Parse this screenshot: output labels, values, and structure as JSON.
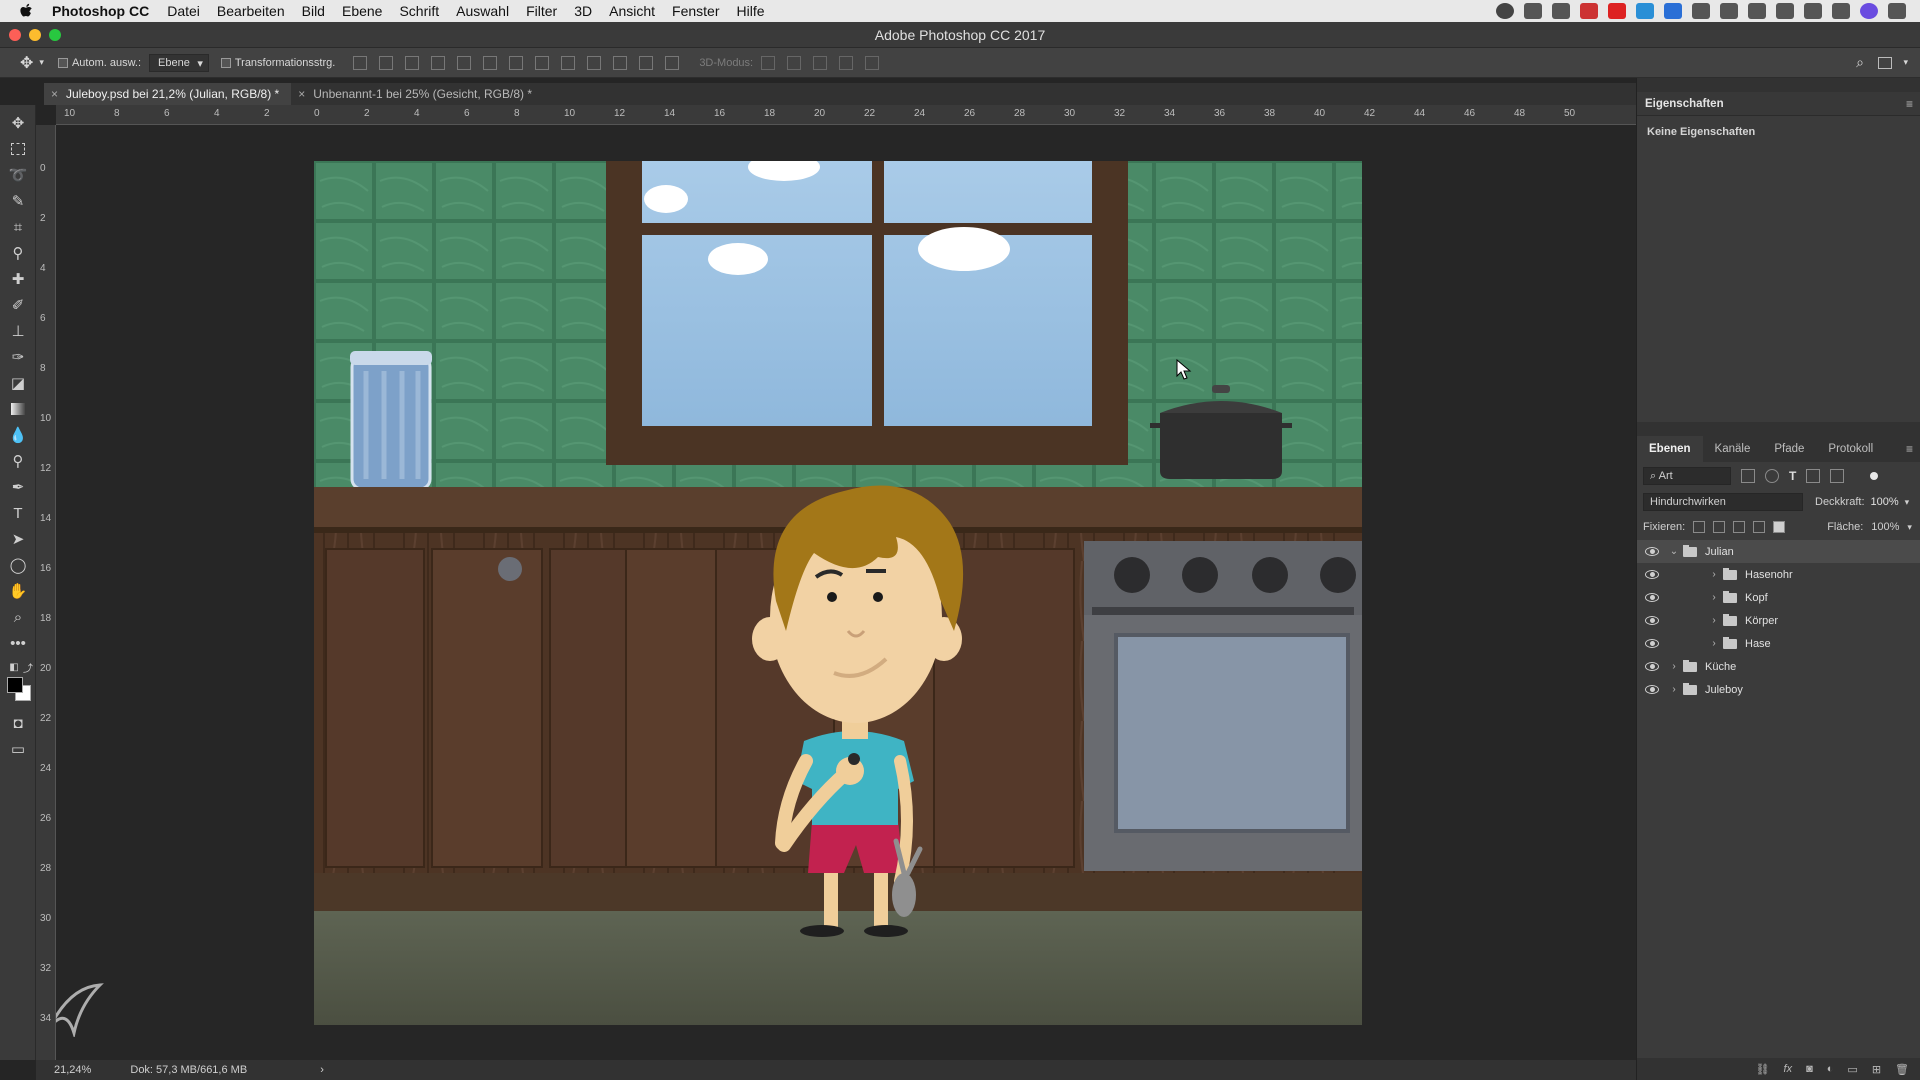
{
  "menubar": {
    "app_name": "Photoshop CC",
    "items": [
      "Datei",
      "Bearbeiten",
      "Bild",
      "Ebene",
      "Schrift",
      "Auswahl",
      "Filter",
      "3D",
      "Ansicht",
      "Fenster",
      "Hilfe"
    ]
  },
  "window": {
    "title": "Adobe Photoshop CC 2017"
  },
  "options": {
    "auto_select_label": "Autom. ausw.:",
    "auto_select_value": "Ebene",
    "transform_label": "Transformationsstrg.",
    "mode_3d_label": "3D-Modus:"
  },
  "tabs": [
    {
      "label": "Juleboy.psd bei 21,2% (Julian, RGB/8) *"
    },
    {
      "label": "Unbenannt-1 bei 25% (Gesicht, RGB/8) *"
    }
  ],
  "ruler": {
    "h_labels": [
      "10",
      "8",
      "6",
      "4",
      "2",
      "0",
      "2",
      "4",
      "6",
      "8",
      "10",
      "12",
      "14",
      "16",
      "18",
      "20",
      "22",
      "24",
      "26",
      "28",
      "30",
      "32",
      "34",
      "36",
      "38",
      "40",
      "42",
      "44",
      "46",
      "48",
      "50"
    ],
    "v_labels": [
      "0",
      "2",
      "4",
      "6",
      "8",
      "10",
      "12",
      "14",
      "16",
      "18",
      "20",
      "22",
      "24",
      "26",
      "28",
      "30",
      "32",
      "34"
    ]
  },
  "status": {
    "zoom": "21,24%",
    "doc_size": "Dok: 57,3 MB/661,6 MB",
    "arrow": "›"
  },
  "properties": {
    "title": "Eigenschaften",
    "empty": "Keine Eigenschaften"
  },
  "layers": {
    "tabs": [
      "Ebenen",
      "Kanäle",
      "Pfade",
      "Protokoll"
    ],
    "filter_label": "Art",
    "blend_mode": "Hindurchwirken",
    "opacity_label": "Deckkraft:",
    "opacity_value": "100%",
    "lock_label": "Fixieren:",
    "fill_label": "Fläche:",
    "fill_value": "100%",
    "items": [
      {
        "name": "Julian"
      },
      {
        "name": "Hasenohr"
      },
      {
        "name": "Kopf"
      },
      {
        "name": "Körper"
      },
      {
        "name": "Hase"
      },
      {
        "name": "Küche"
      },
      {
        "name": "Juleboy"
      }
    ]
  },
  "colors": {
    "accent_close": "#fc5f57",
    "accent_min": "#fdbc2e",
    "accent_max": "#28c840",
    "tile_green": "#3f7a5a",
    "sky_blue": "#9fc3e1",
    "wood_dark": "#4e3626",
    "shirt_teal": "#3fb4c4",
    "shorts_red": "#c2224f"
  }
}
